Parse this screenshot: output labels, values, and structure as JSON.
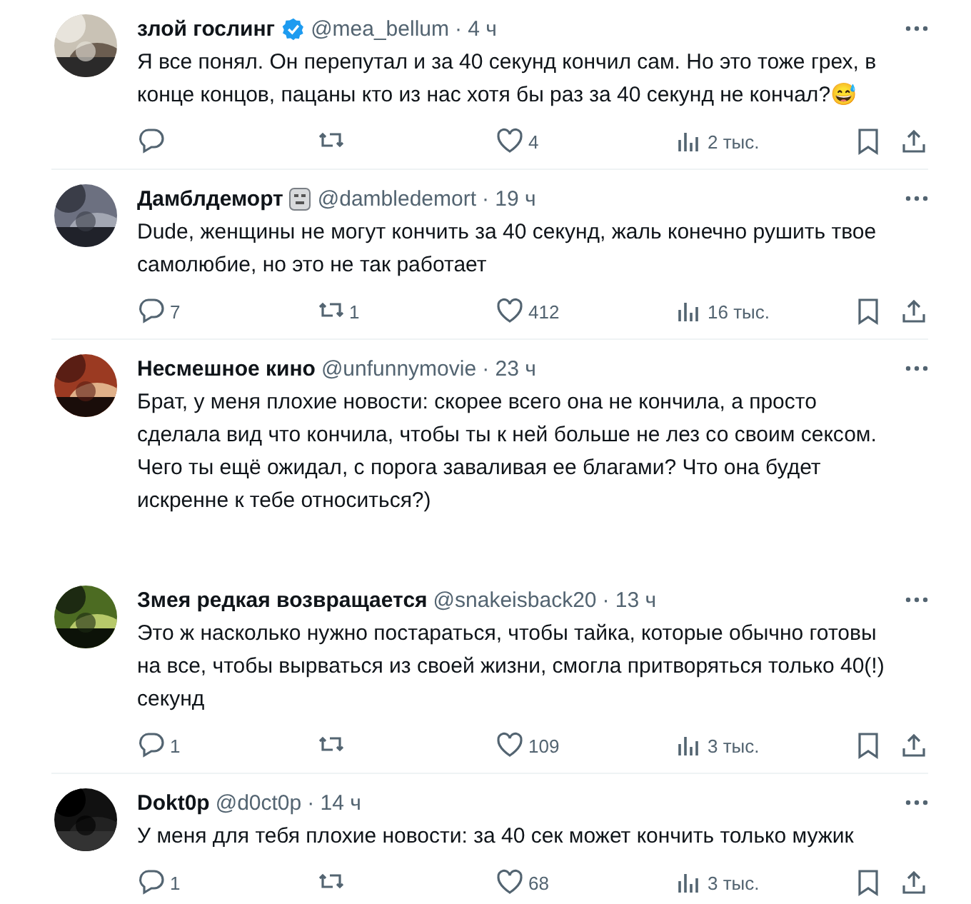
{
  "tweets": [
    {
      "name": "злой гослинг",
      "verified": true,
      "face_icon": false,
      "handle": "@mea_bellum",
      "time": "· 4 ч",
      "text": "Я все понял. Он перепутал и за 40 секунд кончил сам. Но это тоже грех, в конце концов, пацаны кто из нас хотя бы раз за 40 секунд не кончал?😅",
      "actions": {
        "likes": "4",
        "views": "2 тыс."
      }
    },
    {
      "name": "Дамблдеморт",
      "verified": false,
      "face_icon": true,
      "handle": "@dambledemort",
      "time": "· 19 ч",
      "text": "Dude, женщины не могут кончить за 40 секунд, жаль конечно рушить твое самолюбие, но это не так работает",
      "actions": {
        "replies": "7",
        "reposts": "1",
        "likes": "412",
        "views": "16 тыс."
      }
    },
    {
      "name": "Несмешное кино",
      "verified": false,
      "face_icon": false,
      "handle": "@unfunnymovie",
      "time": "· 23 ч",
      "text": "Брат, у меня плохие новости: скорее всего она не кончила, а просто сделала вид что кончила, чтобы ты к ней больше не лез со своим сексом. Чего ты ещё ожидал, с порога заваливая ее благами? Что она будет искренне к тебе относиться?)"
    },
    {
      "name": "Змея редкая возвращается",
      "verified": false,
      "face_icon": false,
      "handle": "@snakeisback20",
      "time": "· 13 ч",
      "text": "Это ж насколько нужно постараться, чтобы тайка, которые обычно готовы на все, чтобы вырваться из своей жизни, смогла притворяться только 40(!) секунд",
      "actions": {
        "replies": "1",
        "likes": "109",
        "views": "3 тыс."
      }
    },
    {
      "name": "Dokt0p",
      "verified": false,
      "face_icon": false,
      "handle": "@d0ct0p",
      "time": "· 14 ч",
      "text": "У меня для тебя плохие новости: за 40 сек может кончить только мужик",
      "actions": {
        "replies": "1",
        "likes": "68",
        "views": "3 тыс."
      }
    }
  ]
}
